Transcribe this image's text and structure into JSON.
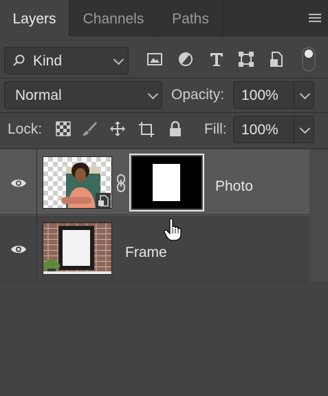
{
  "tabs": [
    {
      "label": "Layers",
      "active": true
    },
    {
      "label": "Channels",
      "active": false
    },
    {
      "label": "Paths",
      "active": false
    }
  ],
  "filter": {
    "kind_label": "Kind",
    "icons": [
      "pixel-layer-filter-icon",
      "adjustment-layer-filter-icon",
      "type-layer-filter-icon",
      "shape-layer-filter-icon",
      "smart-object-filter-icon",
      "filter-toggle-icon"
    ]
  },
  "blend": {
    "mode": "Normal",
    "opacity_label": "Opacity:",
    "opacity_value": "100%"
  },
  "lock": {
    "label": "Lock:",
    "icons": [
      "lock-transparent-pixels-icon",
      "lock-image-pixels-icon",
      "lock-position-icon",
      "lock-artboard-icon",
      "lock-all-icon"
    ],
    "fill_label": "Fill:",
    "fill_value": "100%"
  },
  "layers": [
    {
      "name": "Photo",
      "selected": true,
      "visible": true,
      "has_mask": true,
      "smart_object": true
    },
    {
      "name": "Frame",
      "selected": false,
      "visible": true,
      "has_mask": false,
      "smart_object": false
    }
  ],
  "colors": {
    "panel_bg": "#434343",
    "tab_bar_bg": "#323232",
    "selected_layer_bg": "#585858"
  }
}
